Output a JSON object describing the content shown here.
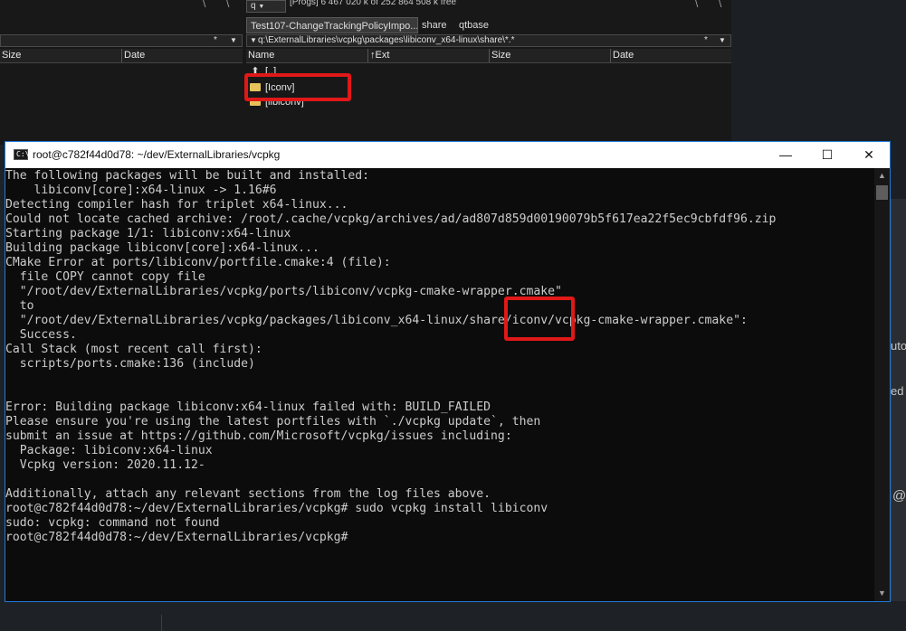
{
  "background": {
    "right_text_1": "uto",
    "right_text_2": "ed",
    "right_text_3": "@"
  },
  "file_manager": {
    "left_pane": {
      "top_glyphs": [
        "\\",
        "\\"
      ],
      "filter_star": "*",
      "filter_arrow": "▼",
      "columns": [
        "Size",
        "Date"
      ]
    },
    "right_pane": {
      "drive_label": "q",
      "free_space": "[Progs]  6 467 020 k of 252 864 508 k free",
      "top_glyphs": [
        "\\",
        "\\"
      ],
      "tabs": [
        "Test107-ChangeTrackingPolicyImpo...",
        "share",
        "qtbase"
      ],
      "path_arrow": "▼",
      "path": "q:\\ExternalLibraries\\vcpkg\\packages\\libiconv_x64-linux\\share\\*.*",
      "filter_star": "*",
      "filter_arrow": "▼",
      "columns": [
        "Name",
        "Ext",
        "Size",
        "Date"
      ],
      "sort_arrow": "↑",
      "rows": [
        {
          "name": "[..]",
          "type": "up"
        },
        {
          "name": "[Iconv]",
          "type": "folder"
        },
        {
          "name": "[libiconv]",
          "type": "folder"
        }
      ]
    }
  },
  "terminal": {
    "title": "root@c782f44d0d78: ~/dev/ExternalLibraries/vcpkg",
    "icon_text": "C:\\",
    "buttons": {
      "minimize": "—",
      "maximize": "☐",
      "close": "✕"
    },
    "lines": [
      "The following packages will be built and installed:",
      "    libiconv[core]:x64-linux -> 1.16#6",
      "Detecting compiler hash for triplet x64-linux...",
      "Could not locate cached archive: /root/.cache/vcpkg/archives/ad/ad807d859d00190079b5f617ea22f5ec9cbfdf96.zip",
      "Starting package 1/1: libiconv:x64-linux",
      "Building package libiconv[core]:x64-linux...",
      "CMake Error at ports/libiconv/portfile.cmake:4 (file):",
      "  file COPY cannot copy file",
      "  \"/root/dev/ExternalLibraries/vcpkg/ports/libiconv/vcpkg-cmake-wrapper.cmake\"",
      "  to",
      "  \"/root/dev/ExternalLibraries/vcpkg/packages/libiconv_x64-linux/share/iconv/vcpkg-cmake-wrapper.cmake\":",
      "  Success.",
      "Call Stack (most recent call first):",
      "  scripts/ports.cmake:136 (include)",
      "",
      "",
      "Error: Building package libiconv:x64-linux failed with: BUILD_FAILED",
      "Please ensure you're using the latest portfiles with `./vcpkg update`, then",
      "submit an issue at https://github.com/Microsoft/vcpkg/issues including:",
      "  Package: libiconv:x64-linux",
      "  Vcpkg version: 2020.11.12-",
      "",
      "Additionally, attach any relevant sections from the log files above.",
      "root@c782f44d0d78:~/dev/ExternalLibraries/vcpkg# sudo vcpkg install libiconv",
      "sudo: vcpkg: command not found",
      "root@c782f44d0d78:~/dev/ExternalLibraries/vcpkg#"
    ],
    "scroll_up": "▲",
    "scroll_down": "▼"
  },
  "colors": {
    "highlight": "#e01818",
    "terminal_border": "#1e7ad4",
    "terminal_bg": "#0c0c0c",
    "terminal_text": "#cccccc",
    "folder": "#e8c25a"
  }
}
